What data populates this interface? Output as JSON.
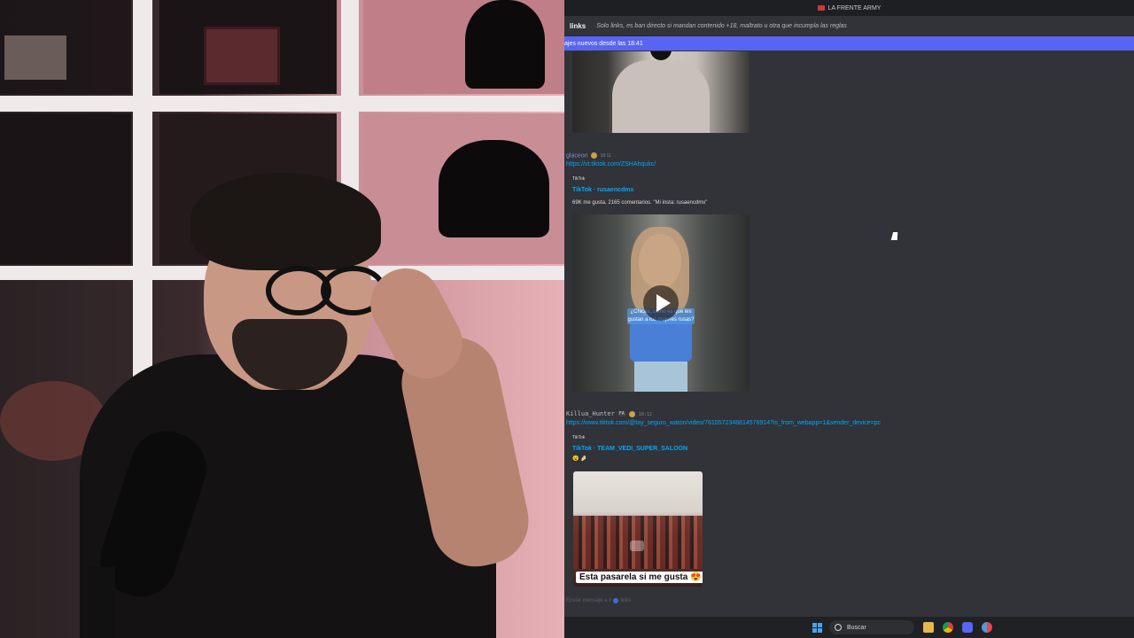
{
  "window": {
    "server_name": "LA FRENTE ARMY"
  },
  "channel": {
    "name": "links",
    "topic": "Solo links, es ban directo si mandan contenido +18, maltrato u otra que incumpla las reglas"
  },
  "new_messages_bar": "ajes nuevos desde las 18:41",
  "messages": [
    {
      "username": "glaceon",
      "time": "18:11",
      "link": "https://vt.tiktok.com/ZSHAhqukc/",
      "embed": {
        "provider": "TikTok",
        "title": "TikTok · rusaencdmx",
        "description": "69K me gusta, 2165 comentarios. \"Mi insta: rusaencdmx\"",
        "overlay_text": "¿Chicas, cómo es que les gustan a los mujeres rusas?"
      }
    },
    {
      "username": "Killua_Hunter",
      "tag": "FA",
      "time": "18:12",
      "link": "https://www.tiktok.com/@tay_seguro_waton/video/7610572348814576914?is_from_webapp=1&sender_device=pc",
      "embed": {
        "provider": "TikTok",
        "title": "TikTok · TEAM_VEDI_SUPER_SALOON",
        "description": "😮 🤌🏻",
        "caption": "Esta pasarela si me gusta 😍"
      }
    }
  ],
  "composer": {
    "placeholder": "Enviar mensaje a #",
    "channel": "links"
  },
  "taskbar": {
    "search_label": "Buscar"
  },
  "colors": {
    "accent": "#5865f2",
    "link": "#00a8fc",
    "background": "#313338"
  }
}
